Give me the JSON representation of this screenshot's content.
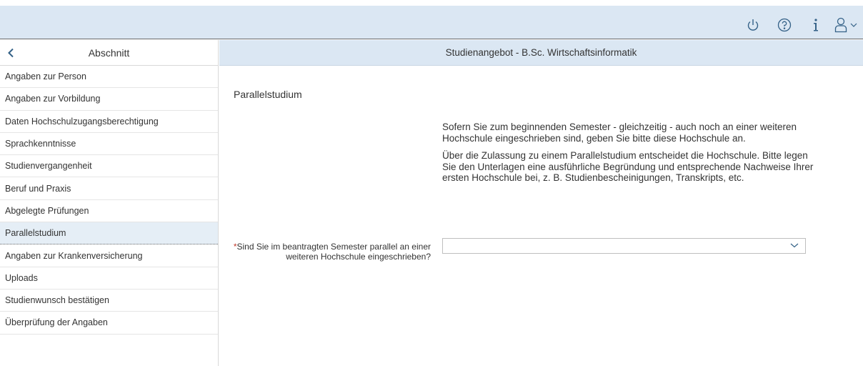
{
  "shellbar": {
    "icons": [
      "power-icon",
      "help-icon",
      "info-icon",
      "user-icon",
      "chevron-down-icon"
    ],
    "accent": "#346187"
  },
  "sidebar": {
    "title": "Abschnitt",
    "items": [
      {
        "label": "Angaben zur Person"
      },
      {
        "label": "Angaben zur Vorbildung"
      },
      {
        "label": "Daten Hochschulzugangsberechtigung"
      },
      {
        "label": "Sprachkenntnisse"
      },
      {
        "label": "Studienvergangenheit"
      },
      {
        "label": "Beruf und Praxis"
      },
      {
        "label": "Abgelegte Prüfungen"
      },
      {
        "label": "Parallelstudium",
        "active": true
      },
      {
        "label": "Angaben zur Krankenversicherung"
      },
      {
        "label": "Uploads"
      },
      {
        "label": "Studienwunsch bestätigen"
      },
      {
        "label": "Überprüfung der Angaben"
      }
    ]
  },
  "content": {
    "header": "Studienangebot - B.Sc. Wirtschaftsinformatik",
    "section_title": "Parallelstudium",
    "paragraph1": "Sofern Sie zum beginnenden Semester - gleichzeitig - auch noch an einer weiteren Hochschule eingeschrieben sind, geben Sie bitte diese Hochschule an.",
    "paragraph2": "Über die Zulassung zu einem Parallelstudium entscheidet die Hochschule. Bitte legen Sie den Unterlagen eine ausführliche Begründung und entsprechende Nachweise Ihrer ersten Hochschule bei, z. B. Studienbescheinigungen, Transkripts, etc.",
    "field": {
      "required_mark": "*",
      "label": "Sind Sie im beantragten Semester parallel an einer weiteren Hochschule eingeschrieben?",
      "value": ""
    }
  }
}
